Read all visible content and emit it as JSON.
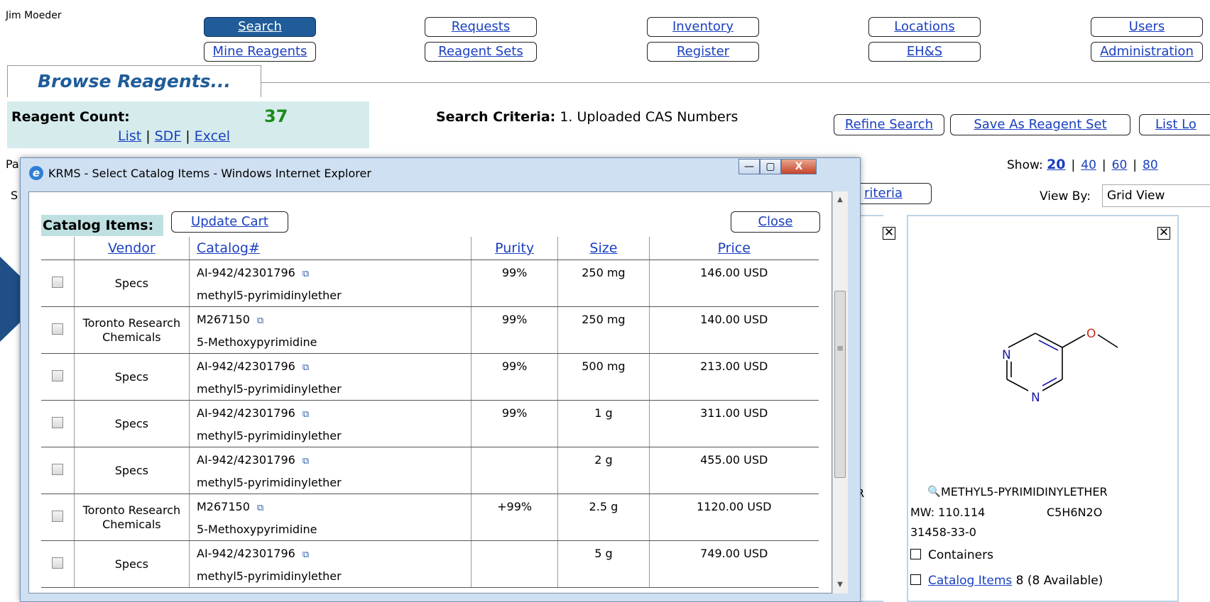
{
  "user": {
    "name": "Jim Moeder"
  },
  "nav": {
    "row1": [
      "Search",
      "Requests",
      "Inventory",
      "Locations",
      "Users"
    ],
    "row2": [
      "Mine Reagents",
      "Reagent Sets",
      "Register",
      "EH&S",
      "Administration"
    ]
  },
  "browse": {
    "title": "Browse Reagents..."
  },
  "reagent_count": {
    "label": "Reagent Count:",
    "value": "37",
    "list": "List",
    "sdf": "SDF",
    "excel": "Excel",
    "sep": "|"
  },
  "search_criteria": {
    "label": "Search Criteria:",
    "value": "1. Uploaded CAS Numbers"
  },
  "actions": {
    "refine": "Refine Search",
    "save_set": "Save As Reagent Set",
    "list_loc": "List Lo"
  },
  "paging": {
    "partial_label": "Pa",
    "partial_s": "S",
    "criteria_partial": "riteria"
  },
  "show": {
    "label": "Show:",
    "options": [
      "20",
      "40",
      "60",
      "80"
    ],
    "current": "20",
    "sep": "|"
  },
  "view_by": {
    "label": "View By:",
    "value": "Grid View"
  },
  "card": {
    "name": "METHYL5-PYRIMIDINYLETHER",
    "mw": "MW:  110.114",
    "formula": "C5H6N2O",
    "cas": "31458-33-0",
    "containers": "Containers",
    "catalog_link": "Catalog Items",
    "catalog_count": "8 (8 Available)",
    "atom_n1": "N",
    "atom_n2": "N",
    "atom_o": "O",
    "partial_r": "R",
    "close_x": "✕"
  },
  "popup": {
    "title": "KRMS - Select Catalog Items - Windows Internet Explorer",
    "catalog_label": "Catalog Items:",
    "update_cart": "Update Cart",
    "close": "Close",
    "columns": [
      "Vendor",
      "Catalog#",
      "Purity",
      "Size",
      "Price"
    ],
    "ctrl_min": "—",
    "ctrl_max": "▢",
    "ctrl_close": "X",
    "rows": [
      {
        "vendor": "Specs",
        "catalog": "AI-942/42301796",
        "name": "methyl5-pyrimidinylether",
        "purity": "99%",
        "size": "250 mg",
        "price": "146.00 USD"
      },
      {
        "vendor": "Toronto Research Chemicals",
        "catalog": "M267150",
        "name": "5-Methoxypyrimidine",
        "purity": "99%",
        "size": "250 mg",
        "price": "140.00 USD"
      },
      {
        "vendor": "Specs",
        "catalog": "AI-942/42301796",
        "name": "methyl5-pyrimidinylether",
        "purity": "99%",
        "size": "500 mg",
        "price": "213.00 USD"
      },
      {
        "vendor": "Specs",
        "catalog": "AI-942/42301796",
        "name": "methyl5-pyrimidinylether",
        "purity": "99%",
        "size": "1 g",
        "price": "311.00 USD"
      },
      {
        "vendor": "Specs",
        "catalog": "AI-942/42301796",
        "name": "methyl5-pyrimidinylether",
        "purity": "",
        "size": "2 g",
        "price": "455.00 USD"
      },
      {
        "vendor": "Toronto Research Chemicals",
        "catalog": "M267150",
        "name": "5-Methoxypyrimidine",
        "purity": "+99%",
        "size": "2.5 g",
        "price": "1120.00 USD"
      },
      {
        "vendor": "Specs",
        "catalog": "AI-942/42301796",
        "name": "methyl5-pyrimidinylether",
        "purity": "",
        "size": "5 g",
        "price": "749.00 USD"
      }
    ]
  },
  "icons": {
    "external_link": "external-link-icon",
    "magnifier": "magnifier-icon",
    "ie": "ie-logo-icon"
  },
  "colors": {
    "active_tab": "#1f5c99",
    "count_bg": "#d6ecec",
    "link": "#1a3fbf",
    "count_value": "#1a8a1a"
  }
}
